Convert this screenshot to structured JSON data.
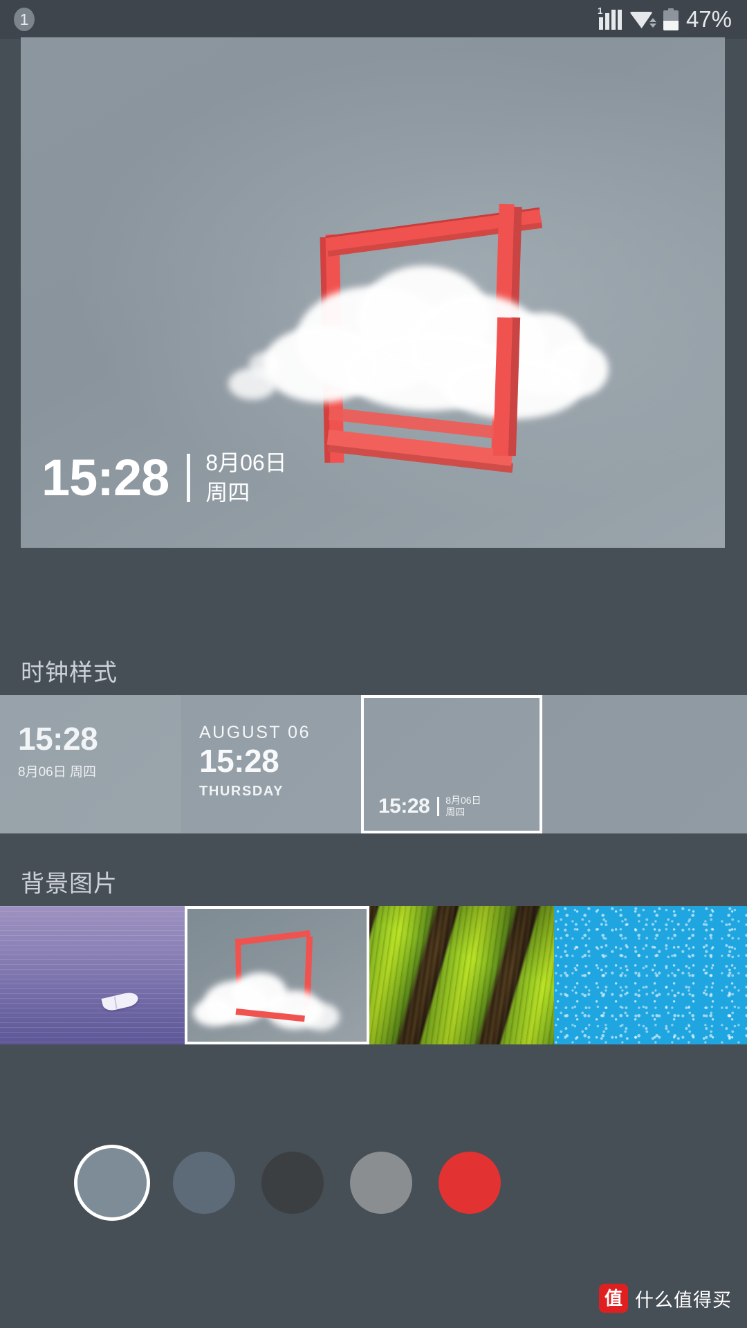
{
  "statusbar": {
    "notification_badge": "1",
    "sim_label": "1",
    "battery_percent": "47%",
    "battery_level": 47,
    "icons": [
      "signal-icon",
      "wifi-icon",
      "battery-icon"
    ]
  },
  "preview": {
    "time": "15:28",
    "date": "8月06日",
    "weekday": "周四"
  },
  "clock_section": {
    "heading": "时钟样式",
    "styles": [
      {
        "id": "style-1",
        "time": "15:28",
        "date_line": "8月06日  周四",
        "selected": false
      },
      {
        "id": "style-2",
        "top_label": "AUGUST 06",
        "time": "15:28",
        "bottom_label": "THURSDAY",
        "selected": false
      },
      {
        "id": "style-3",
        "time": "15:28",
        "date": "8月06日",
        "weekday": "周四",
        "selected": true
      },
      {
        "id": "style-4",
        "selected": false
      }
    ]
  },
  "background_section": {
    "heading": "背景图片",
    "wallpapers": [
      {
        "id": "wallpaper-purple-boat",
        "name": "purple-boat",
        "selected": false
      },
      {
        "id": "wallpaper-cloud-frame",
        "name": "cloud-frame",
        "selected": true
      },
      {
        "id": "wallpaper-green-fields",
        "name": "green-fields",
        "selected": false
      },
      {
        "id": "wallpaper-blue-texture",
        "name": "blue-texture",
        "selected": false
      }
    ]
  },
  "color_swatches": [
    {
      "id": "swatch-1",
      "color": "#7d8c96",
      "selected": true
    },
    {
      "id": "swatch-2",
      "color": "#5d6b78",
      "selected": false
    },
    {
      "id": "swatch-3",
      "color": "#3c3f42",
      "selected": false
    },
    {
      "id": "swatch-4",
      "color": "#8b8e90",
      "selected": false
    },
    {
      "id": "swatch-5",
      "color": "#e33232",
      "selected": false
    }
  ],
  "watermark": {
    "logo_text": "值",
    "text": "什么值得买",
    "logo_color": "#e02020"
  },
  "theme": {
    "page_bg": "#464e56",
    "statusbar_bg": "#3e454c",
    "text_primary": "#e6e9eb",
    "accent_red": "#f0534f"
  }
}
